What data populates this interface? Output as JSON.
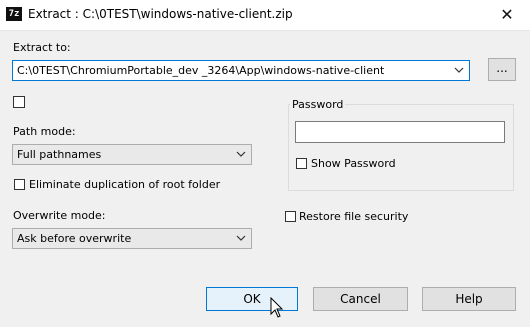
{
  "window": {
    "icon_label": "7z",
    "title": "Extract : C:\\0TEST\\windows-native-client.zip",
    "close_glyph": "✕"
  },
  "extract": {
    "label": "Extract to:",
    "path_value": "C:\\0TEST\\ChromiumPortable_dev _3264\\App\\windows-native-client",
    "browse_label": "..."
  },
  "path_mode": {
    "label": "Path mode:",
    "selected": "Full pathnames"
  },
  "eliminate_duplication": {
    "label": "Eliminate duplication of root folder",
    "checked": false
  },
  "overwrite_mode": {
    "label": "Overwrite mode:",
    "selected": "Ask before overwrite"
  },
  "password": {
    "group_label": "Password",
    "value": "",
    "show_label": "Show Password",
    "show_checked": false
  },
  "restore_security": {
    "label": "Restore file security",
    "checked": false
  },
  "buttons": {
    "ok": "OK",
    "cancel": "Cancel",
    "help": "Help"
  }
}
